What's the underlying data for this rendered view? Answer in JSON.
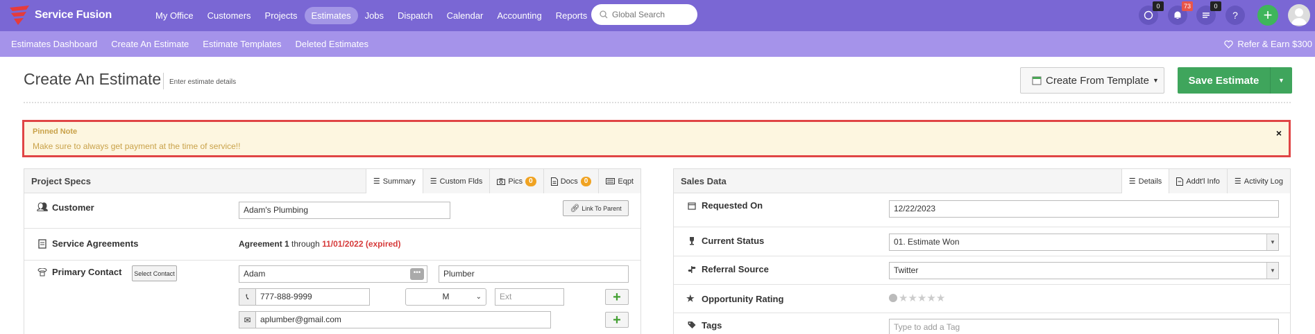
{
  "app": {
    "brand": "Service Fusion"
  },
  "nav": {
    "items": [
      {
        "label": "My Office"
      },
      {
        "label": "Customers"
      },
      {
        "label": "Projects"
      },
      {
        "label": "Estimates",
        "active": true
      },
      {
        "label": "Jobs"
      },
      {
        "label": "Dispatch"
      },
      {
        "label": "Calendar"
      },
      {
        "label": "Accounting"
      },
      {
        "label": "Reports"
      }
    ],
    "search_placeholder": "Global Search",
    "chat_count": "0",
    "notifications_count": "73",
    "tasks_count": "0",
    "help_icon": "?",
    "add_icon": "+"
  },
  "subnav": {
    "items": [
      {
        "label": "Estimates Dashboard"
      },
      {
        "label": "Create An Estimate"
      },
      {
        "label": "Estimate Templates"
      },
      {
        "label": "Deleted Estimates"
      }
    ],
    "refer": "Refer & Earn $300"
  },
  "header": {
    "title": "Create An Estimate",
    "subtitle": "Enter estimate details",
    "template_button": "Create From Template",
    "save_button": "Save Estimate"
  },
  "pinned_note": {
    "title": "Pinned Note",
    "text": "Make sure to always get payment at the time of service!!",
    "close": "×"
  },
  "project_specs": {
    "title": "Project Specs",
    "tabs": [
      {
        "label": "Summary",
        "icon": "list-icon"
      },
      {
        "label": "Custom Flds",
        "icon": "list-icon"
      },
      {
        "label": "Pics",
        "icon": "camera-icon",
        "count": "0"
      },
      {
        "label": "Docs",
        "icon": "document-icon",
        "count": "0"
      },
      {
        "label": "Eqpt",
        "icon": "equipment-icon"
      }
    ],
    "customer": {
      "label": "Customer",
      "value": "Adam's Plumbing",
      "link_button": "Link To Parent"
    },
    "agreements": {
      "label": "Service Agreements",
      "name": "Agreement 1",
      "through": "through",
      "date": "11/01/2022 (expired)"
    },
    "primary_contact": {
      "label": "Primary Contact",
      "select_button": "Select Contact",
      "first_name": "Adam",
      "last_name": "Plumber",
      "phone": "777-888-9999",
      "phone_type": "M",
      "ext_placeholder": "Ext",
      "email": "aplumber@gmail.com"
    }
  },
  "sales_data": {
    "title": "Sales Data",
    "tabs": [
      {
        "label": "Details",
        "icon": "list-icon"
      },
      {
        "label": "Addt'l Info",
        "icon": "document-icon"
      },
      {
        "label": "Activity Log",
        "icon": "lines-icon"
      }
    ],
    "requested_on": {
      "label": "Requested On",
      "value": "12/22/2023"
    },
    "current_status": {
      "label": "Current Status",
      "value": "01. Estimate Won"
    },
    "referral_source": {
      "label": "Referral Source",
      "value": "Twitter"
    },
    "opportunity_rating": {
      "label": "Opportunity Rating",
      "stars": 0,
      "max": 5
    },
    "tags": {
      "label": "Tags",
      "placeholder": "Type to add a Tag"
    }
  },
  "colors": {
    "topbar": "#7a67d4",
    "subbar": "#a593ea",
    "save": "#3fa55c",
    "expired": "#d63a3a",
    "note_text": "#c9a24a"
  }
}
